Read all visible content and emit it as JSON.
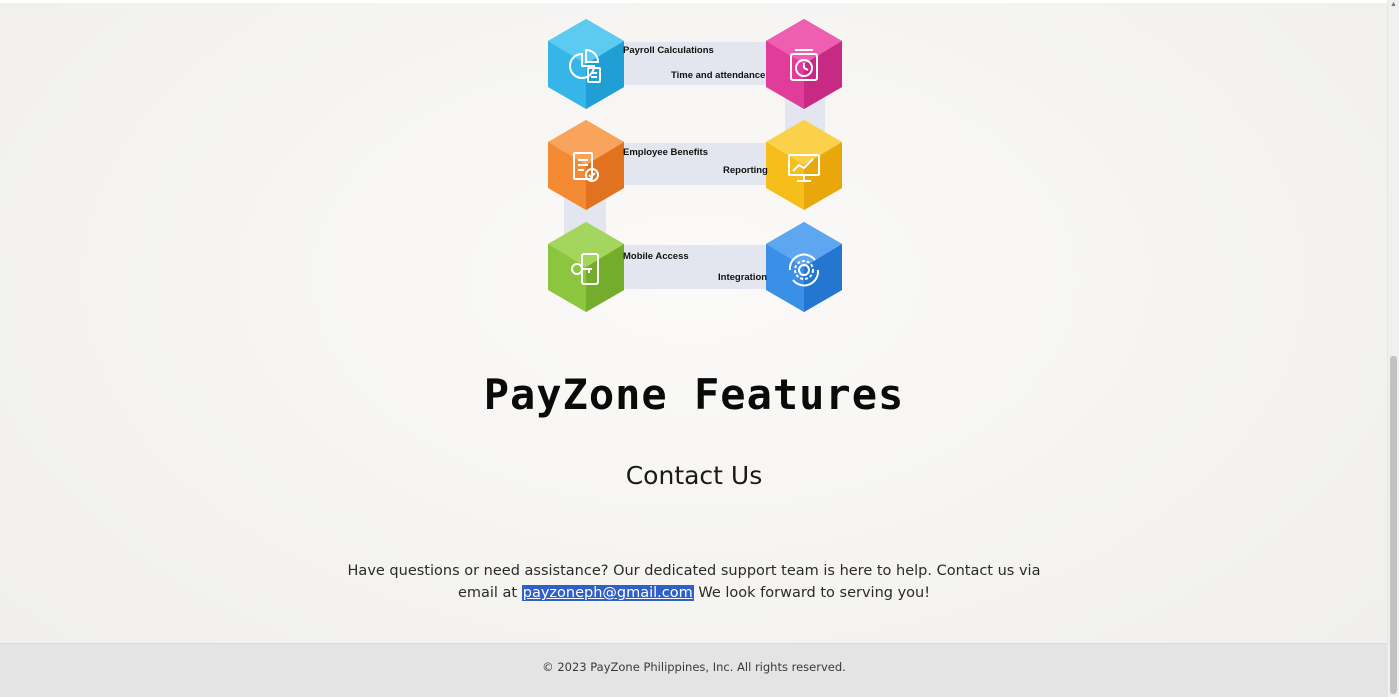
{
  "features_diagram": {
    "items": [
      {
        "label": "Payroll Calculations",
        "color": "#36b6e8",
        "icon": "pie-chart-calculator-icon"
      },
      {
        "label": "Time and attendance",
        "color": "#e23c9b",
        "icon": "time-clock-icon"
      },
      {
        "label": "Employee Benefits",
        "color": "#f58a34",
        "icon": "document-check-icon"
      },
      {
        "label": "Reporting",
        "color": "#f7bd1b",
        "icon": "chart-monitor-icon"
      },
      {
        "label": "Mobile Access",
        "color": "#8cc63f",
        "icon": "mobile-key-icon"
      },
      {
        "label": "Integration",
        "color": "#3a8fe6",
        "icon": "gear-sync-icon"
      }
    ]
  },
  "features": {
    "title": "PayZone Features"
  },
  "contact": {
    "title": "Contact Us",
    "text_before": "Have questions or need assistance? Our dedicated support team is here to help. Contact us via email at ",
    "email": "payzoneph@gmail.com",
    "text_after": " We look forward to serving you!"
  },
  "footer": {
    "copyright": "© 2023 PayZone Philippines, Inc. All rights reserved."
  }
}
